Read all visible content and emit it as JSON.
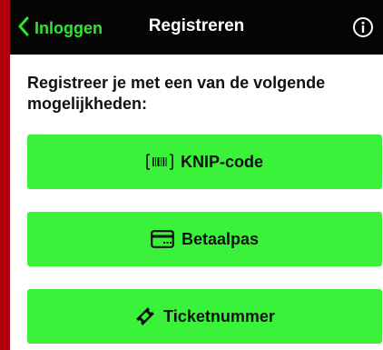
{
  "nav": {
    "back_label": "Inloggen",
    "title": "Registreren",
    "back_icon": "chevron-left-icon",
    "info_icon": "info-icon"
  },
  "intro": "Registreer je met een van de volgende mogelijkheden:",
  "options": [
    {
      "label": "KNIP-code",
      "icon": "barcode-icon"
    },
    {
      "label": "Betaalpas",
      "icon": "card-icon"
    },
    {
      "label": "Ticketnummer",
      "icon": "ticket-icon"
    }
  ],
  "colors": {
    "accent_green": "#3af23a",
    "back_link_green": "#2ee62e",
    "nav_background": "#050505",
    "side_red": "#b3000f"
  }
}
